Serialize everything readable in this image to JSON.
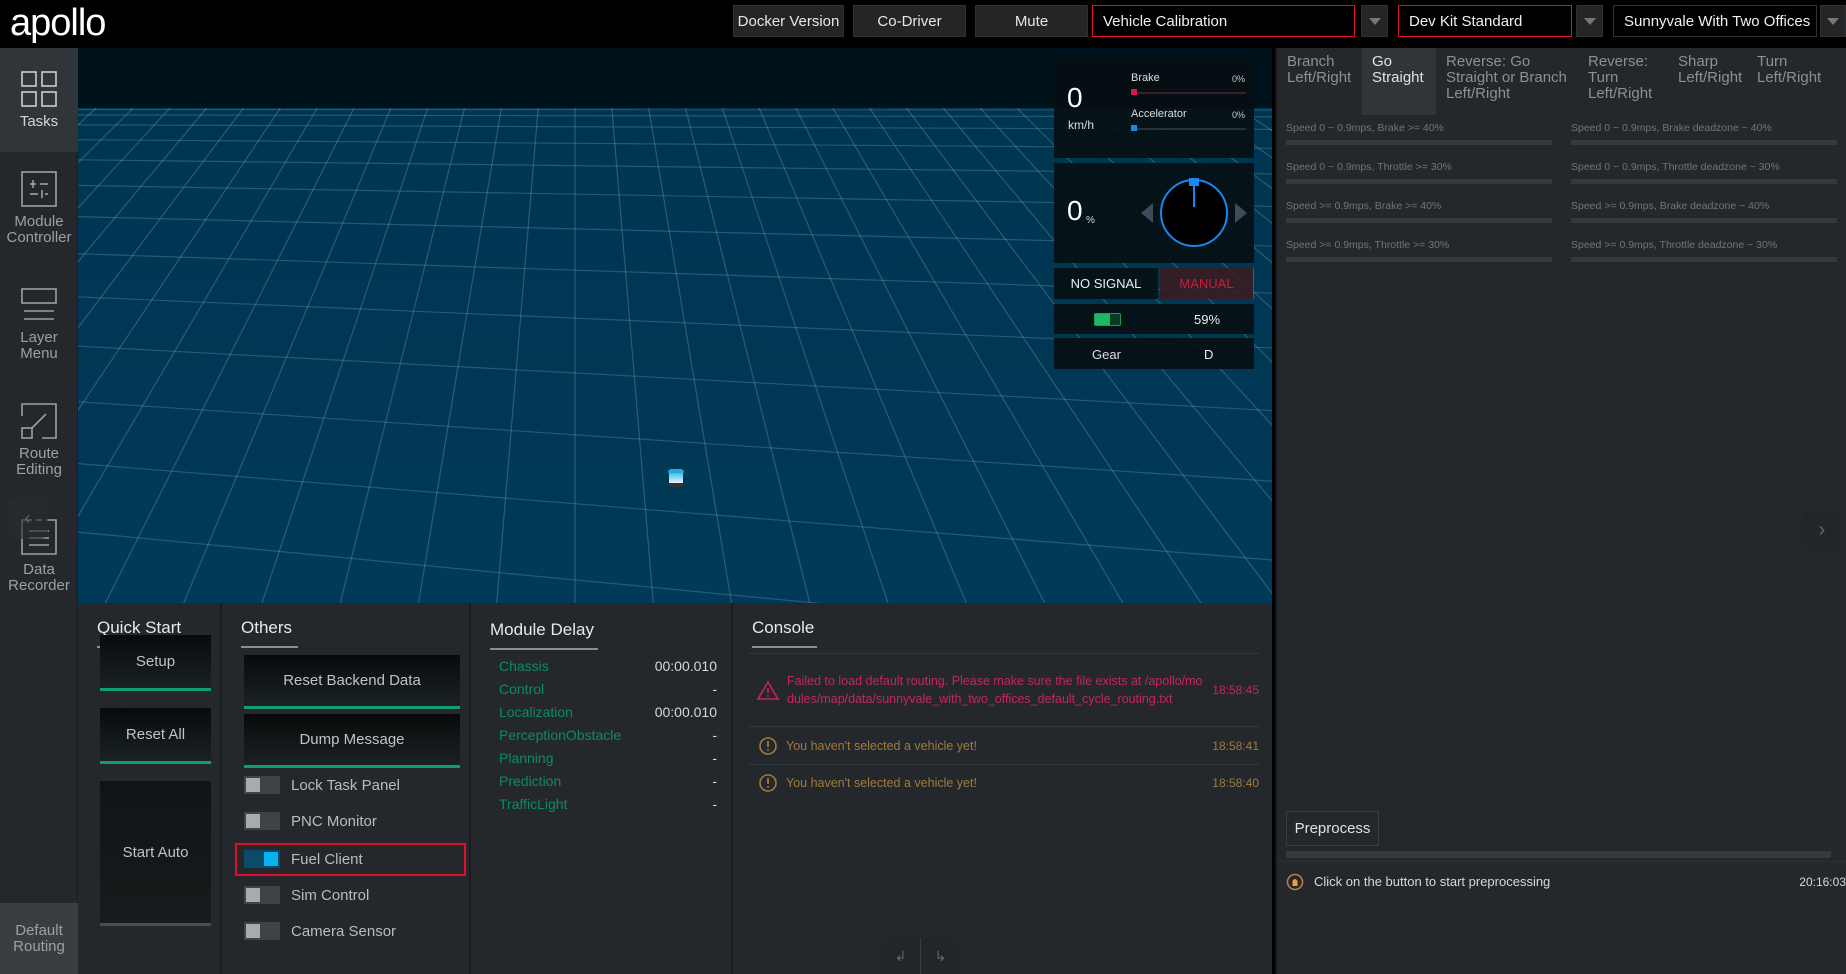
{
  "app": {
    "logo": "apollo"
  },
  "header": {
    "docker_version": "Docker Version",
    "co_driver": "Co-Driver",
    "mute": "Mute",
    "mode_select": "Vehicle Calibration",
    "vehicle_select": "Dev Kit Standard",
    "map_select": "Sunnyvale With Two Offices"
  },
  "sidebar": {
    "items": [
      {
        "label_1": "Tasks",
        "label_2": ""
      },
      {
        "label_1": "Module",
        "label_2": "Controller"
      },
      {
        "label_1": "Layer",
        "label_2": "Menu"
      },
      {
        "label_1": "Route",
        "label_2": "Editing"
      },
      {
        "label_1": "Data",
        "label_2": "Recorder"
      }
    ],
    "default_routing_1": "Default",
    "default_routing_2": "Routing"
  },
  "dashboard": {
    "speed": "0",
    "speed_unit": "km/h",
    "brake_label": "Brake",
    "brake_pct": "0%",
    "brake_value": 0,
    "accel_label": "Accelerator",
    "accel_pct": "0%",
    "accel_value": 0,
    "steering": "0",
    "steering_unit": "%",
    "signal": "NO SIGNAL",
    "driving_mode": "MANUAL",
    "battery_pct": "59%",
    "battery_value": 59,
    "gear_label": "Gear",
    "gear_value": "D"
  },
  "quick_start": {
    "title": "Quick Start",
    "setup": "Setup",
    "reset_all": "Reset All",
    "start_auto": "Start Auto"
  },
  "others": {
    "title": "Others",
    "reset_backend": "Reset Backend Data",
    "dump_message": "Dump Message",
    "toggles": [
      {
        "label": "Lock Task Panel",
        "on": false
      },
      {
        "label": "PNC Monitor",
        "on": false
      },
      {
        "label": "Fuel Client",
        "on": true
      },
      {
        "label": "Sim Control",
        "on": false
      },
      {
        "label": "Camera Sensor",
        "on": false
      }
    ]
  },
  "module_delay": {
    "title": "Module Delay",
    "rows": [
      {
        "name": "Chassis",
        "value": "00:00.010"
      },
      {
        "name": "Control",
        "value": "-"
      },
      {
        "name": "Localization",
        "value": "00:00.010"
      },
      {
        "name": "PerceptionObstacle",
        "value": "-"
      },
      {
        "name": "Planning",
        "value": "-"
      },
      {
        "name": "Prediction",
        "value": "-"
      },
      {
        "name": "TrafficLight",
        "value": "-"
      }
    ]
  },
  "console": {
    "title": "Console",
    "messages": [
      {
        "level": "error",
        "text": "Failed to load default routing. Please make sure the file exists at /apollo/modules/map/data/sunnyvale_with_two_offices_default_cycle_routing.txt",
        "time": "18:58:45"
      },
      {
        "level": "warning",
        "text": "You haven't selected a vehicle yet!",
        "time": "18:58:41"
      },
      {
        "level": "warning",
        "text": "You haven't selected a vehicle yet!",
        "time": "18:58:40"
      }
    ]
  },
  "calibration": {
    "tabs": [
      {
        "label": "Branch Left/Right",
        "active": false
      },
      {
        "label": "Go Straight",
        "active": true
      },
      {
        "label": "Reverse: Go Straight or Branch Left/Right",
        "active": false
      },
      {
        "label": "Reverse: Turn Left/Right",
        "active": false
      },
      {
        "label": "Sharp Left/Right",
        "active": false
      },
      {
        "label": "Turn Left/Right",
        "active": false
      }
    ],
    "requirements": [
      {
        "label": "Speed 0 ~ 0.9mps, Brake >= 40%",
        "progress": 0
      },
      {
        "label": "Speed 0 ~ 0.9mps, Brake deadzone ~ 40%",
        "progress": 0
      },
      {
        "label": "Speed 0 ~ 0.9mps, Throttle >= 30%",
        "progress": 0
      },
      {
        "label": "Speed 0 ~ 0.9mps, Throttle deadzone ~ 30%",
        "progress": 0
      },
      {
        "label": "Speed >= 0.9mps, Brake >= 40%",
        "progress": 0
      },
      {
        "label": "Speed >= 0.9mps, Brake deadzone ~ 40%",
        "progress": 0
      },
      {
        "label": "Speed >= 0.9mps, Throttle >= 30%",
        "progress": 0
      },
      {
        "label": "Speed >= 0.9mps, Throttle deadzone ~ 30%",
        "progress": 0
      }
    ],
    "preprocess_label": "Preprocess",
    "preprocess_progress": 0,
    "log_message": "Click on the button to start preprocessing",
    "log_time": "20:16:03"
  },
  "colors": {
    "highlight_red": "#e0102a",
    "accent_green": "#0d9f73",
    "toggle_on": "#09b1ef",
    "error_text": "#c4265a",
    "warning_text": "#a07a3c"
  }
}
